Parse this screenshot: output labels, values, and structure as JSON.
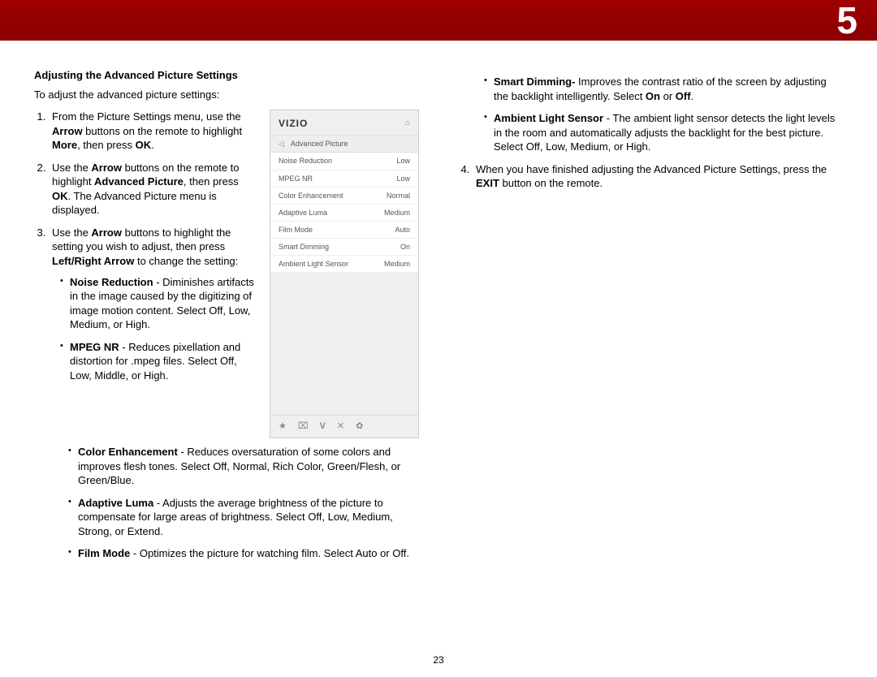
{
  "chapter": "5",
  "page_number": "23",
  "section_title": "Adjusting the Advanced Picture Settings",
  "intro": "To adjust the advanced picture settings:",
  "step1": {
    "p1": "From the Picture Settings menu, use the ",
    "b1": "Arrow",
    "p2": " buttons on the remote to highlight ",
    "b2": "More",
    "p3": ", then press ",
    "b3": "OK",
    "p4": "."
  },
  "step2": {
    "p1": "Use the ",
    "b1": "Arrow",
    "p2": " buttons on the remote to highlight ",
    "b2": "Advanced Picture",
    "p3": ", then press ",
    "b3": "OK",
    "p4": ". The Advanced Picture menu is displayed."
  },
  "step3": {
    "p1": "Use the ",
    "b1": "Arrow",
    "p2": " buttons to highlight the setting you wish to adjust, then press ",
    "b2": "Left/Right Arrow",
    "p3": " to change the setting:"
  },
  "bullets_left": {
    "noise": {
      "b": "Noise Reduction",
      "t": " - Diminishes artifacts in the image caused by the digitizing of image motion content. Select Off, Low, Medium, or High."
    },
    "mpeg": {
      "b": "MPEG NR",
      "t": " - Reduces pixellation and distortion for .mpeg files. Select Off, Low, Middle, or High."
    },
    "color": {
      "b": "Color Enhancement",
      "t": " - Reduces oversaturation of some colors and improves flesh tones. Select Off, Normal, Rich Color, Green/Flesh, or Green/Blue."
    },
    "luma": {
      "b": "Adaptive Luma",
      "t": " - Adjusts the average brightness of the picture to compensate for large areas of brightness. Select Off, Low, Medium, Strong, or Extend."
    },
    "film": {
      "b": "Film Mode",
      "t": " - Optimizes the picture for watching film. Select Auto or Off."
    }
  },
  "bullets_right": {
    "smart": {
      "b": "Smart Dimming-",
      "t1": " Improves the contrast ratio of the screen by adjusting the backlight intelligently. Select ",
      "b1": "On",
      "t2": " or ",
      "b2": "Off",
      "t3": "."
    },
    "ambient": {
      "b": "Ambient Light Sensor",
      "t": " - The ambient light sensor detects the light levels in the room and automatically adjusts the backlight for the best picture. Select Off, Low, Medium, or High."
    }
  },
  "step4": {
    "p1": "When you have finished adjusting the Advanced Picture Settings, press the ",
    "b1": "EXIT",
    "p2": " button on the remote."
  },
  "tv": {
    "logo": "VIZIO",
    "title": "Advanced Picture",
    "rows": [
      {
        "label": "Noise Reduction",
        "value": "Low"
      },
      {
        "label": "MPEG NR",
        "value": "Low"
      },
      {
        "label": "Color Enhancement",
        "value": "Normal"
      },
      {
        "label": "Adaptive Luma",
        "value": "Medium"
      },
      {
        "label": "Film Mode",
        "value": "Auto"
      },
      {
        "label": "Smart Dimming",
        "value": "On"
      },
      {
        "label": "Ambient Light Sensor",
        "value": "Medium"
      }
    ],
    "footer_icons": [
      "star-icon",
      "tv-icon",
      "v-icon",
      "close-icon",
      "gear-icon"
    ]
  }
}
